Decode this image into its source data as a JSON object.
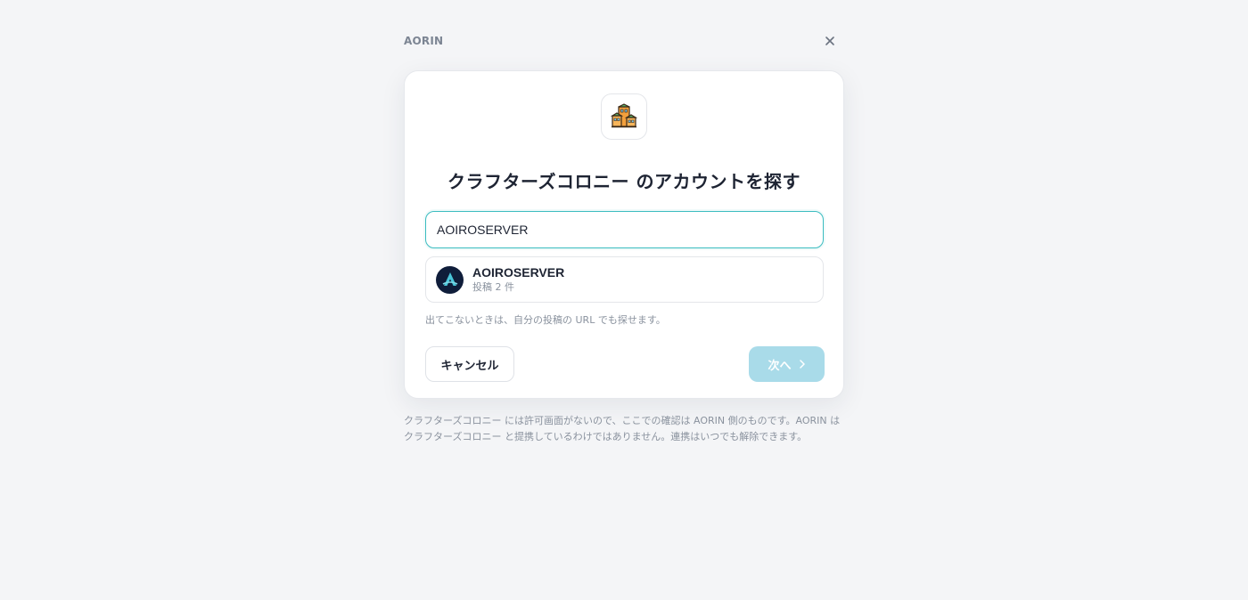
{
  "header": {
    "brand": "AORIN",
    "close_icon": "close-icon"
  },
  "card": {
    "app_icon": "building-icon",
    "title": "クラフターズコロニー のアカウントを探す",
    "search": {
      "value": "AOIROSERVER",
      "placeholder": ""
    },
    "result": {
      "avatar_icon": "aoiro-logo-icon",
      "name": "AOIROSERVER",
      "sub": "投稿 2 件"
    },
    "hint": "出てこないときは、自分の投稿の URL でも探せます。",
    "cancel_label": "キャンセル",
    "next_label": "次へ",
    "next_icon": "chevron-right-icon"
  },
  "footer": {
    "note": "クラフターズコロニー には許可画面がないので、ここでの確認は AORIN 側のものです。AORIN は クラフターズコロニー と提携しているわけではありません。連携はいつでも解除できます。"
  },
  "colors": {
    "accent": "#3bbcc0",
    "next_button_disabled": "#a9dbe9",
    "background": "#f4f5f7",
    "avatar_bg": "#0f1d3a"
  }
}
